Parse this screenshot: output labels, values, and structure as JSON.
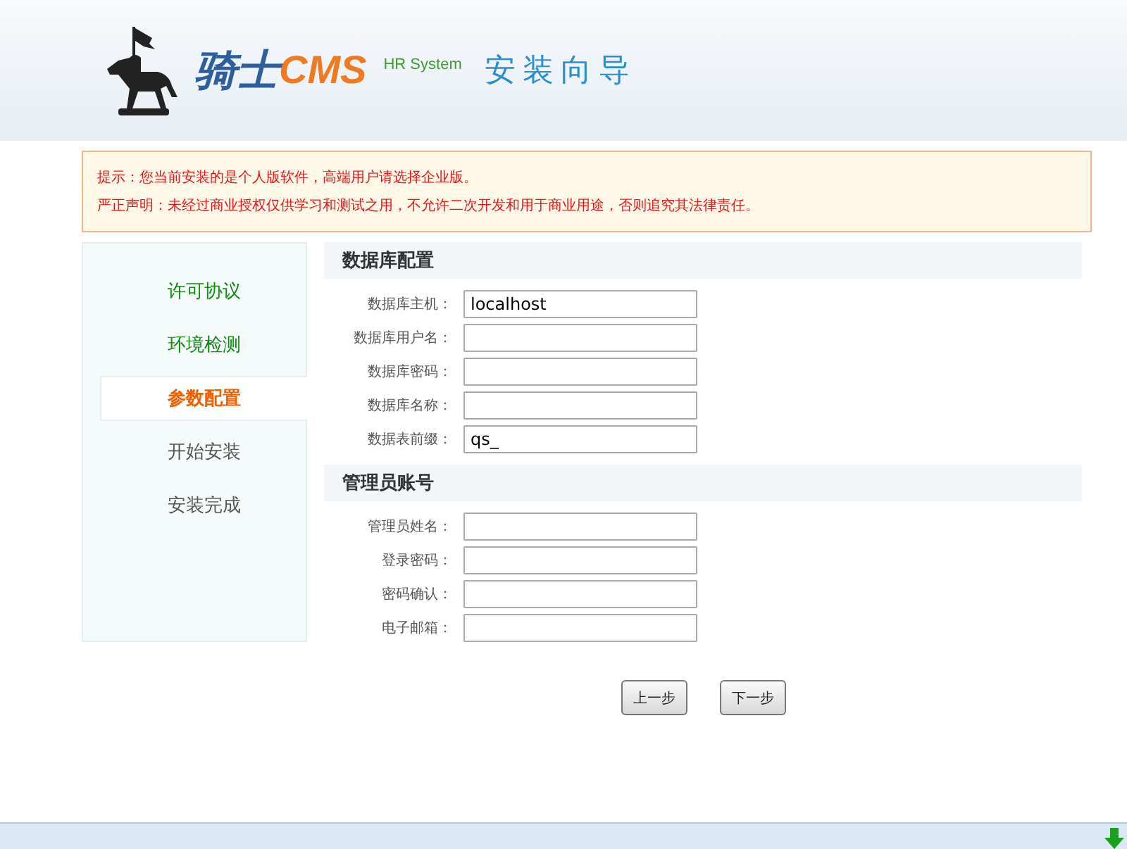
{
  "header": {
    "brand": "骑士",
    "brand_suffix": "CMS",
    "subtitle": "HR System",
    "title": "安装向导"
  },
  "notice": [
    "提示：您当前安装的是个人版软件，高端用户请选择企业版。",
    "严正声明：未经过商业授权仅供学习和测试之用，不允许二次开发和用于商业用途，否则追究其法律责任。"
  ],
  "steps": [
    {
      "label": "许可协议",
      "done": true,
      "selected": false
    },
    {
      "label": "环境检测",
      "done": true,
      "selected": false
    },
    {
      "label": "参数配置",
      "done": false,
      "selected": true
    },
    {
      "label": "开始安装",
      "done": false,
      "selected": false
    },
    {
      "label": "安装完成",
      "done": false,
      "selected": false
    }
  ],
  "sections": [
    {
      "title": "数据库配置",
      "fields": [
        {
          "label": "数据库主机：",
          "value": "localhost"
        },
        {
          "label": "数据库用户名："
        },
        {
          "label": "数据库密码："
        },
        {
          "label": "数据库名称："
        },
        {
          "label": "数据表前缀：",
          "value": "qs_"
        }
      ]
    },
    {
      "title": "管理员账号",
      "fields": [
        {
          "label": "管理员姓名："
        },
        {
          "label": "登录密码："
        },
        {
          "label": "密码确认："
        },
        {
          "label": "电子邮箱："
        }
      ]
    }
  ],
  "buttons": [
    "上一步",
    "下一步"
  ]
}
